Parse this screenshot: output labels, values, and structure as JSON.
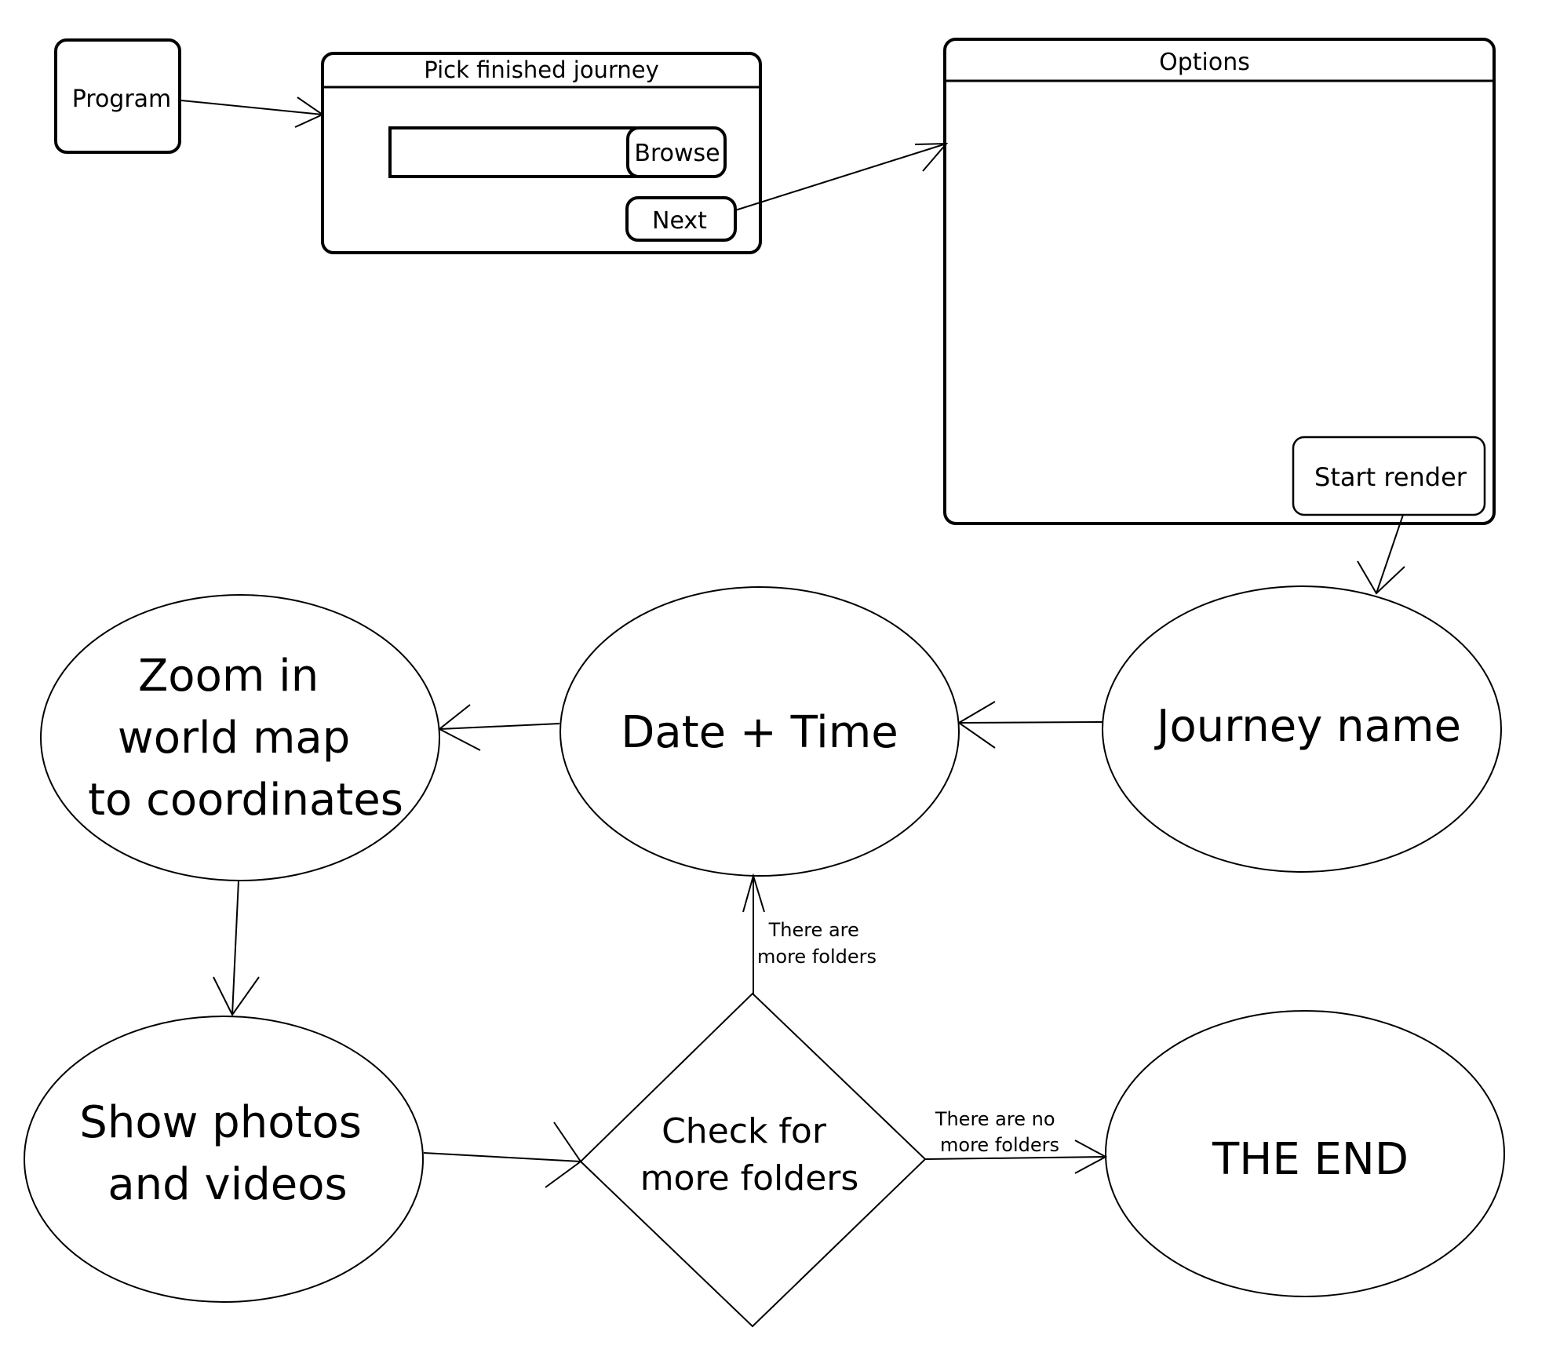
{
  "program": {
    "label": "Program"
  },
  "pick_window": {
    "title": "Pick finished journey",
    "path_value": "",
    "browse_label": "Browse",
    "next_label": "Next"
  },
  "options_window": {
    "title": "Options",
    "start_render_label": "Start render"
  },
  "nodes": {
    "journey_name": [
      "Journey name"
    ],
    "date_time": [
      "Date + Time"
    ],
    "zoom_map": [
      "Zoom in",
      "world map",
      "to coordinates"
    ],
    "show_photos": [
      "Show photos",
      "and videos"
    ],
    "check_folders": [
      "Check for",
      "more folders"
    ],
    "the_end": [
      "THE END"
    ]
  },
  "edge_labels": {
    "more_folders": [
      "There are",
      "more folders"
    ],
    "no_more_folders": [
      "There are no",
      "more folders"
    ]
  },
  "colors": {
    "stroke": "#000000",
    "fill": "#ffffff"
  }
}
